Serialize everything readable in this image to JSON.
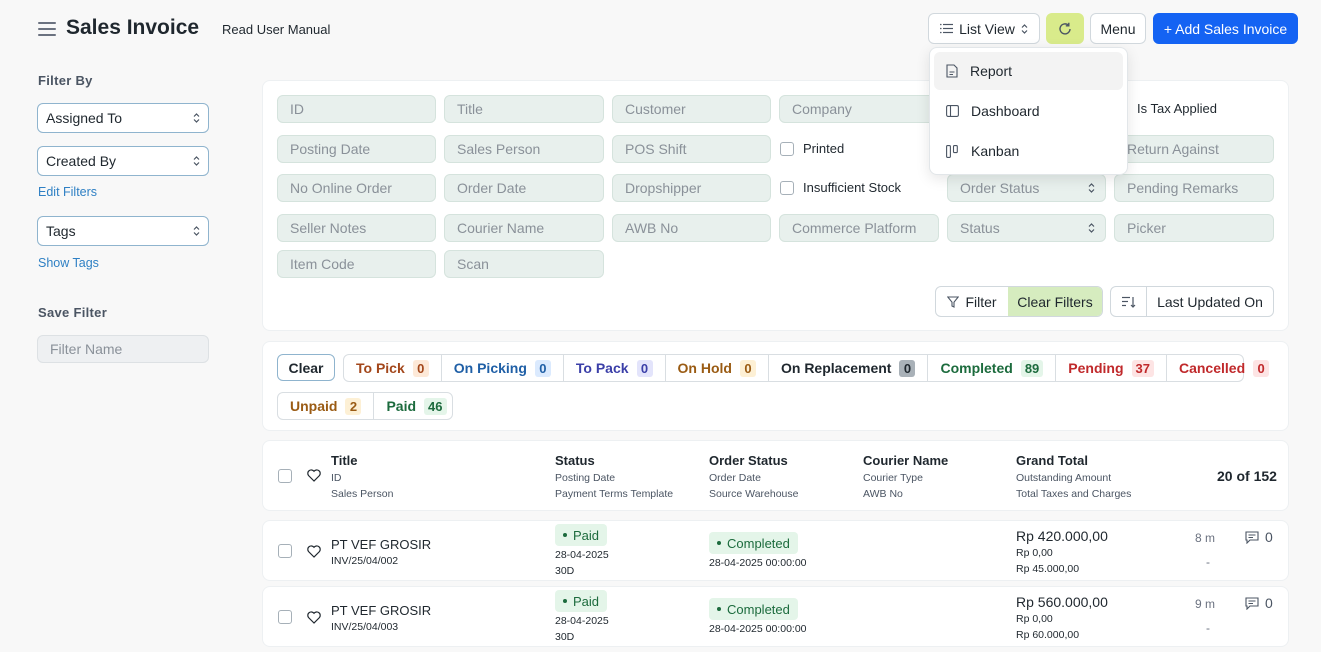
{
  "header": {
    "title": "Sales Invoice",
    "manual_link": "Read User Manual",
    "list_view_label": "List View",
    "menu_label": "Menu",
    "add_label": "+ Add Sales Invoice"
  },
  "view_dropdown": {
    "items": [
      {
        "label": "Report",
        "icon": "report-icon"
      },
      {
        "label": "Dashboard",
        "icon": "dashboard-icon"
      },
      {
        "label": "Kanban",
        "icon": "kanban-icon"
      }
    ]
  },
  "sidebar": {
    "filter_by": "Filter By",
    "assigned_to": "Assigned To",
    "created_by": "Created By",
    "edit_filters": "Edit Filters",
    "tags": "Tags",
    "show_tags": "Show Tags",
    "save_filter": "Save Filter",
    "filter_name_placeholder": "Filter Name"
  },
  "filters": {
    "row1": [
      "ID",
      "Title",
      "Customer",
      "Company"
    ],
    "is_tax_applied": "Is Tax Applied",
    "row2": [
      "Posting Date",
      "Sales Person",
      "POS Shift"
    ],
    "printed": "Printed",
    "return_against": "Return Against",
    "row3": [
      "No Online Order",
      "Order Date",
      "Dropshipper"
    ],
    "insufficient_stock": "Insufficient Stock",
    "order_status": "Order Status",
    "pending_remarks": "Pending Remarks",
    "row4": [
      "Seller Notes",
      "Courier Name",
      "AWB No",
      "Commerce Platform"
    ],
    "status": "Status",
    "picker": "Picker",
    "row5": [
      "Item Code",
      "Scan"
    ],
    "filter_btn": "Filter",
    "clear_filters_btn": "Clear Filters",
    "sort_label": "Last Updated On"
  },
  "status_bar": {
    "clear": "Clear",
    "group1": [
      {
        "label": "To Pick",
        "count": "0",
        "color": "#a3471b",
        "bg": "#fde9d8"
      },
      {
        "label": "On Picking",
        "count": "0",
        "color": "#1f5fa6",
        "bg": "#dbeafe"
      },
      {
        "label": "To Pack",
        "count": "0",
        "color": "#3b3fa8",
        "bg": "#e3e4fb"
      },
      {
        "label": "On Hold",
        "count": "0",
        "color": "#9a5b13",
        "bg": "#fdf0d5"
      },
      {
        "label": "On Replacement",
        "count": "0",
        "color": "#1f272e",
        "bg": "#a9b1b8"
      },
      {
        "label": "Completed",
        "count": "89",
        "color": "#1c6b3d",
        "bg": "#e4f5e9"
      },
      {
        "label": "Pending",
        "count": "37",
        "color": "#c0292b",
        "bg": "#fde4e4"
      },
      {
        "label": "Cancelled",
        "count": "0",
        "color": "#c0292b",
        "bg": "#fde4e4"
      }
    ],
    "group2": [
      {
        "label": "Unpaid",
        "count": "2",
        "color": "#9a5b13",
        "bg": "#fdf0d5"
      },
      {
        "label": "Paid",
        "count": "46",
        "color": "#1c6b3d",
        "bg": "#e4f5e9"
      }
    ]
  },
  "list_header": {
    "title": "Title",
    "title_s1": "ID",
    "title_s2": "Sales Person",
    "status": "Status",
    "status_s1": "Posting Date",
    "status_s2": "Payment Terms Template",
    "order_status": "Order Status",
    "order_s1": "Order Date",
    "order_s2": "Source Warehouse",
    "courier": "Courier Name",
    "courier_s1": "Courier Type",
    "courier_s2": "AWB No",
    "grand_total": "Grand Total",
    "gt_s1": "Outstanding Amount",
    "gt_s2": "Total Taxes and Charges",
    "count": "20 of 152"
  },
  "rows": [
    {
      "title": "PT VEF GROSIR",
      "id": "INV/25/04/002",
      "status": "Paid",
      "posting_date": "28-04-2025",
      "terms": "30D",
      "order_status": "Completed",
      "order_date": "28-04-2025 00:00:00",
      "grand_total": "Rp 420.000,00",
      "outstanding": "Rp 0,00",
      "taxes": "Rp 45.000,00",
      "modified": "8 m",
      "dash": "-",
      "comments": "0"
    },
    {
      "title": "PT VEF GROSIR",
      "id": "INV/25/04/003",
      "status": "Paid",
      "posting_date": "28-04-2025",
      "terms": "30D",
      "order_status": "Completed",
      "order_date": "28-04-2025 00:00:00",
      "grand_total": "Rp 560.000,00",
      "outstanding": "Rp 0,00",
      "taxes": "Rp 60.000,00",
      "modified": "9 m",
      "dash": "-",
      "comments": "0"
    }
  ]
}
